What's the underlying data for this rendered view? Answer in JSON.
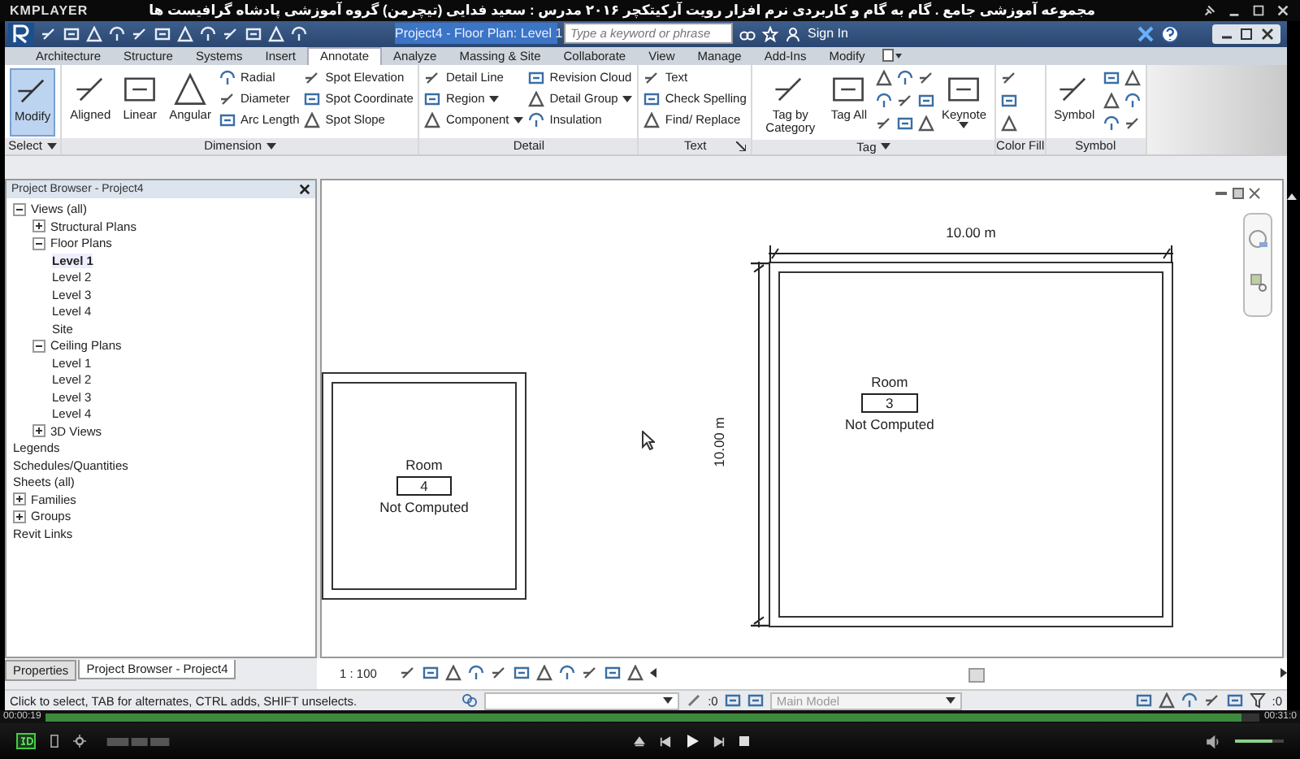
{
  "player": {
    "name": "KMPLAYER",
    "title": "مجموعه آموزشی جامع . گام به گام و کاربردی نرم افزار رویت آرکیتکچر ۲۰۱۶  مدرس : سعید فدایی (تیچرمن) گروه آموزشی پادشاه گرافیست ها",
    "elapsed": "00:00:19",
    "total": "00:31:0",
    "seek": {
      "level": 0.985
    },
    "volume": {
      "level": 0.75
    }
  },
  "app": {
    "document_title": "Project4 - Floor Plan: Level 1",
    "search": {
      "placeholder": "Type a keyword or phrase"
    },
    "sign_in": "Sign In"
  },
  "ribbon_tabs": [
    {
      "label": "Architecture",
      "selected": false
    },
    {
      "label": "Structure",
      "selected": false
    },
    {
      "label": "Systems",
      "selected": false
    },
    {
      "label": "Insert",
      "selected": false
    },
    {
      "label": "Annotate",
      "selected": true
    },
    {
      "label": "Analyze",
      "selected": false
    },
    {
      "label": "Massing & Site",
      "selected": false
    },
    {
      "label": "Collaborate",
      "selected": false
    },
    {
      "label": "View",
      "selected": false
    },
    {
      "label": "Manage",
      "selected": false
    },
    {
      "label": "Add-Ins",
      "selected": false
    },
    {
      "label": "Modify",
      "selected": false
    }
  ],
  "ribbon_panels": [
    {
      "label": "Select",
      "menu": true,
      "launcher": false,
      "groups": [
        {
          "kind": "large",
          "label": "Modify",
          "selected": true,
          "dropdown": false
        }
      ]
    },
    {
      "label": "Dimension",
      "menu": true,
      "launcher": false,
      "groups": [
        {
          "kind": "large",
          "label": "Aligned",
          "selected": false,
          "dropdown": false
        },
        {
          "kind": "large",
          "label": "Linear",
          "selected": false,
          "dropdown": false
        },
        {
          "kind": "large",
          "label": "Angular",
          "selected": false,
          "dropdown": false
        },
        {
          "kind": "stack",
          "items": [
            {
              "label": "Radial",
              "dropdown": false
            },
            {
              "label": "Diameter",
              "dropdown": false
            },
            {
              "label": "Arc Length",
              "dropdown": false
            }
          ]
        },
        {
          "kind": "stack",
          "items": [
            {
              "label": "Spot Elevation",
              "dropdown": false
            },
            {
              "label": "Spot Coordinate",
              "dropdown": false
            },
            {
              "label": "Spot Slope",
              "dropdown": false
            }
          ]
        }
      ]
    },
    {
      "label": "Detail",
      "menu": false,
      "launcher": false,
      "groups": [
        {
          "kind": "stack",
          "items": [
            {
              "label": "Detail Line",
              "dropdown": false
            },
            {
              "label": "Region",
              "dropdown": true
            },
            {
              "label": "Component",
              "dropdown": true
            }
          ]
        },
        {
          "kind": "stack",
          "items": [
            {
              "label": "Revision Cloud",
              "dropdown": false
            },
            {
              "label": "Detail Group",
              "dropdown": true
            },
            {
              "label": "Insulation",
              "dropdown": false
            }
          ]
        }
      ]
    },
    {
      "label": "Text",
      "menu": false,
      "launcher": true,
      "groups": [
        {
          "kind": "stack",
          "items": [
            {
              "label": "Text",
              "dropdown": false
            },
            {
              "label": "Check Spelling",
              "dropdown": false
            },
            {
              "label": "Find/ Replace",
              "dropdown": false
            }
          ]
        }
      ]
    },
    {
      "label": "Tag",
      "menu": true,
      "launcher": false,
      "groups": [
        {
          "kind": "large",
          "label": "Tag by Category",
          "selected": false,
          "dropdown": false
        },
        {
          "kind": "large",
          "label": "Tag All",
          "selected": false,
          "dropdown": false
        },
        {
          "kind": "icons"
        },
        {
          "kind": "icons"
        },
        {
          "kind": "icons"
        },
        {
          "kind": "large",
          "label": "Keynote",
          "selected": false,
          "dropdown": true
        }
      ]
    },
    {
      "label": "Color Fill",
      "menu": false,
      "launcher": false,
      "groups": [
        {
          "kind": "icons"
        }
      ]
    },
    {
      "label": "Symbol",
      "menu": false,
      "launcher": false,
      "groups": [
        {
          "kind": "large",
          "label": "Symbol",
          "selected": false,
          "dropdown": false
        },
        {
          "kind": "icons"
        },
        {
          "kind": "icons"
        }
      ]
    }
  ],
  "project_browser": {
    "title": "Project Browser - Project4",
    "tree": [
      {
        "label": "Views (all)",
        "kind": "folder",
        "expanded": true,
        "selected": false,
        "children": [
          {
            "label": "Structural Plans",
            "kind": "folder",
            "expanded": false,
            "selected": false
          },
          {
            "label": "Floor Plans",
            "kind": "folder",
            "expanded": true,
            "selected": false,
            "children": [
              {
                "label": "Level 1",
                "kind": "leaf",
                "selected": true
              },
              {
                "label": "Level 2",
                "kind": "leaf",
                "selected": false
              },
              {
                "label": "Level 3",
                "kind": "leaf",
                "selected": false
              },
              {
                "label": "Level 4",
                "kind": "leaf",
                "selected": false
              },
              {
                "label": "Site",
                "kind": "leaf",
                "selected": false
              }
            ]
          },
          {
            "label": "Ceiling Plans",
            "kind": "folder",
            "expanded": true,
            "selected": false,
            "children": [
              {
                "label": "Level 1",
                "kind": "leaf",
                "selected": false
              },
              {
                "label": "Level 2",
                "kind": "leaf",
                "selected": false
              },
              {
                "label": "Level 3",
                "kind": "leaf",
                "selected": false
              },
              {
                "label": "Level 4",
                "kind": "leaf",
                "selected": false
              }
            ]
          },
          {
            "label": "3D Views",
            "kind": "folder",
            "expanded": false,
            "selected": false
          }
        ]
      },
      {
        "label": "Legends",
        "kind": "leaf",
        "selected": false
      },
      {
        "label": "Schedules/Quantities",
        "kind": "leaf",
        "selected": false
      },
      {
        "label": "Sheets (all)",
        "kind": "leaf",
        "selected": false
      },
      {
        "label": "Families",
        "kind": "folder",
        "expanded": false,
        "selected": false
      },
      {
        "label": "Groups",
        "kind": "folder",
        "expanded": false,
        "selected": false
      },
      {
        "label": "Revit Links",
        "kind": "leaf",
        "selected": false
      }
    ]
  },
  "panel_tabs": [
    {
      "label": "Properties",
      "selected": false
    },
    {
      "label": "Project Browser - Project4",
      "selected": true
    }
  ],
  "rooms": [
    {
      "name": "Room",
      "number": "4",
      "area": "Not Computed"
    },
    {
      "name": "Room",
      "number": "3",
      "area": "Not Computed",
      "width_dimension": "10.00 m",
      "height_dimension": "10.00 m"
    }
  ],
  "view_scale": "1 : 100",
  "status_bar": {
    "message": "Click to select, TAB for alternates, CTRL adds, SHIFT unselects.",
    "workset_count": ":0",
    "model": {
      "value": "Main Model",
      "disabled": true
    },
    "filter_count": ":0"
  }
}
